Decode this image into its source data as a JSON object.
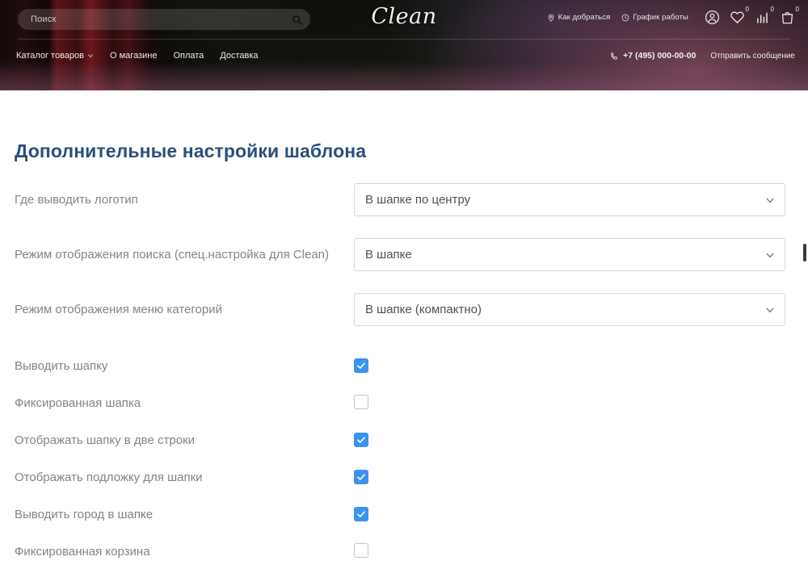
{
  "site_header": {
    "search": {
      "placeholder": "Поиск",
      "value": "",
      "icon": "search-icon"
    },
    "logo": "Clean",
    "top_links": [
      {
        "label": "Как добраться",
        "icon": "location-pin-icon"
      },
      {
        "label": "График работы",
        "icon": "clock-icon"
      }
    ],
    "top_icons": [
      {
        "name": "user-circle-icon",
        "badge": ""
      },
      {
        "name": "heart-icon",
        "badge": "0"
      },
      {
        "name": "compare-bars-icon",
        "badge": "0"
      },
      {
        "name": "shopping-bag-icon",
        "badge": "0"
      }
    ],
    "nav": [
      {
        "label": "Каталог товаров",
        "has_chevron": true
      },
      {
        "label": "О магазине",
        "has_chevron": false
      },
      {
        "label": "Оплата",
        "has_chevron": false
      },
      {
        "label": "Доставка",
        "has_chevron": false
      }
    ],
    "phone": {
      "label": "+7 (495) 000-00-00",
      "icon": "phone-icon"
    },
    "message_link": "Отправить сообщение"
  },
  "page": {
    "title": "Дополнительные настройки шаблона",
    "accent_color": "#2a4f7d",
    "checkbox_color": "#3c92f0",
    "settings": [
      {
        "type": "select",
        "label": "Где выводить логотип",
        "value": "В шапке по центру"
      },
      {
        "type": "select",
        "label": "Режим отображения поиска (спец.настройка для Clean)",
        "value": "В шапке"
      },
      {
        "type": "select",
        "label": "Режим отображения меню категорий",
        "value": "В шапке (компактно)"
      },
      {
        "type": "checkbox",
        "label": "Выводить шапку",
        "checked": true
      },
      {
        "type": "checkbox",
        "label": "Фиксированная шапка",
        "checked": false
      },
      {
        "type": "checkbox",
        "label": "Отображать шапку в две строки",
        "checked": true
      },
      {
        "type": "checkbox",
        "label": "Отображать подложку для шапки",
        "checked": true
      },
      {
        "type": "checkbox",
        "label": "Выводить город в шапке",
        "checked": true
      },
      {
        "type": "checkbox",
        "label": "Фиксированная корзина",
        "checked": false
      }
    ]
  }
}
